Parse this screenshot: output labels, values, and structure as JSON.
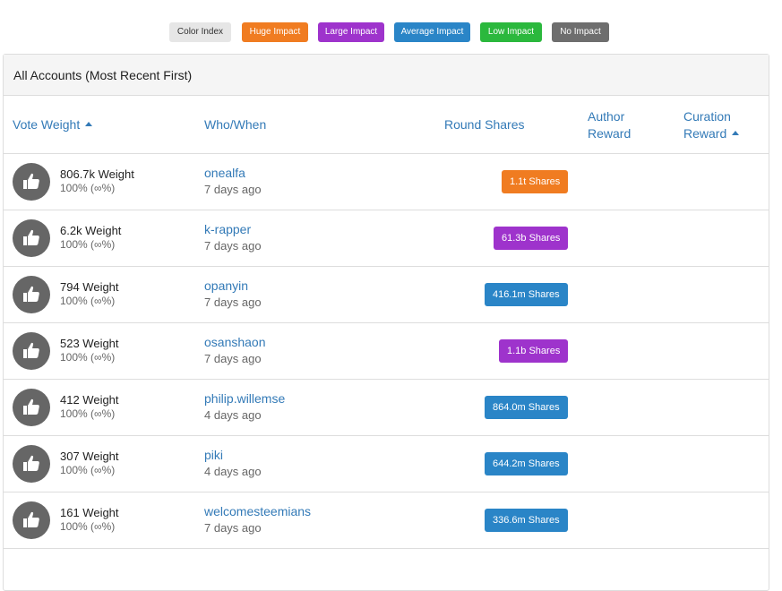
{
  "legend": {
    "color_index": {
      "label": "Color Index",
      "bg": "#e6e6e6",
      "fg": "#333333"
    },
    "huge": {
      "label": "Huge Impact",
      "bg": "#f07c21"
    },
    "large": {
      "label": "Large Impact",
      "bg": "#9e33cc"
    },
    "average": {
      "label": "Average Impact",
      "bg": "#2a85c7"
    },
    "low": {
      "label": "Low Impact",
      "bg": "#2bb83d"
    },
    "none": {
      "label": "No Impact",
      "bg": "#6e6e6e"
    }
  },
  "panel": {
    "title": "All Accounts (Most Recent First)"
  },
  "columns": {
    "vote_weight": "Vote Weight",
    "who_when": "Who/When",
    "round_shares": "Round Shares",
    "author_reward_1": "Author",
    "author_reward_2": "Reward",
    "curation_reward_1": "Curation",
    "curation_reward_2": "Reward"
  },
  "sort": {
    "vote_weight": "ascending",
    "curation_reward": "ascending"
  },
  "icons": {
    "avatar": "thumbs-up-icon",
    "sort": "caret-up-icon"
  },
  "rows": [
    {
      "weight": "806.7k Weight",
      "pct": "100% (∞%)",
      "voter": "onealfa",
      "when": "7 days ago",
      "shares": "1.1t Shares",
      "impact": "huge"
    },
    {
      "weight": "6.2k Weight",
      "pct": "100% (∞%)",
      "voter": "k-rapper",
      "when": "7 days ago",
      "shares": "61.3b Shares",
      "impact": "large"
    },
    {
      "weight": "794 Weight",
      "pct": "100% (∞%)",
      "voter": "opanyin",
      "when": "7 days ago",
      "shares": "416.1m Shares",
      "impact": "average"
    },
    {
      "weight": "523 Weight",
      "pct": "100% (∞%)",
      "voter": "osanshaon",
      "when": "7 days ago",
      "shares": "1.1b Shares",
      "impact": "large"
    },
    {
      "weight": "412 Weight",
      "pct": "100% (∞%)",
      "voter": "philip.willemse",
      "when": "4 days ago",
      "shares": "864.0m Shares",
      "impact": "average"
    },
    {
      "weight": "307 Weight",
      "pct": "100% (∞%)",
      "voter": "piki",
      "when": "4 days ago",
      "shares": "644.2m Shares",
      "impact": "average"
    },
    {
      "weight": "161 Weight",
      "pct": "100% (∞%)",
      "voter": "welcomesteemians",
      "when": "7 days ago",
      "shares": "336.6m Shares",
      "impact": "average"
    }
  ],
  "impact_colors": {
    "huge": "#f07c21",
    "large": "#9e33cc",
    "average": "#2a85c7",
    "low": "#2bb83d",
    "none": "#6e6e6e"
  }
}
